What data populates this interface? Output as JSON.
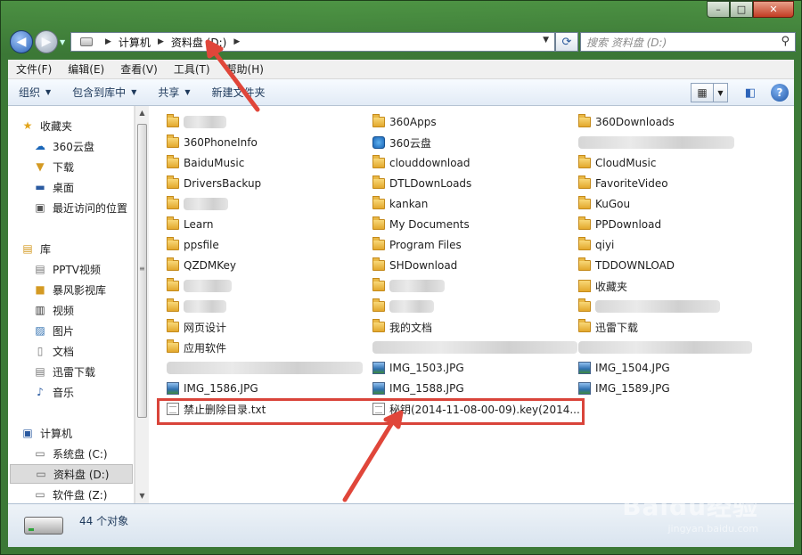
{
  "window": {
    "caption": {
      "minimize": "–",
      "maximize": "□",
      "close": "✕"
    }
  },
  "address": {
    "crumbs": [
      "计算机",
      "资料盘 (D:)"
    ],
    "search_placeholder": "搜索 资料盘 (D:)"
  },
  "menu": [
    "文件(F)",
    "编辑(E)",
    "查看(V)",
    "工具(T)",
    "帮助(H)"
  ],
  "commands": [
    {
      "label": "组织",
      "dropdown": true
    },
    {
      "label": "包含到库中",
      "dropdown": true
    },
    {
      "label": "共享",
      "dropdown": true
    },
    {
      "label": "新建文件夹",
      "dropdown": false
    }
  ],
  "nav": {
    "favorites": {
      "label": "收藏夹",
      "items": [
        "360云盘",
        "下载",
        "桌面",
        "最近访问的位置"
      ]
    },
    "libraries": {
      "label": "库",
      "items": [
        "PPTV视频",
        "暴风影视库",
        "视频",
        "图片",
        "文档",
        "迅雷下载",
        "音乐"
      ]
    },
    "computer": {
      "label": "计算机",
      "items": [
        "系统盘 (C:)",
        "资料盘 (D:)",
        "软件盘 (Z:)"
      ],
      "selected": "资料盘 (D:)"
    }
  },
  "files": [
    {
      "name": "",
      "type": "folder",
      "blurred": true
    },
    {
      "name": "360Apps",
      "type": "folder"
    },
    {
      "name": "360Downloads",
      "type": "folder"
    },
    {
      "name": "360PhoneInfo",
      "type": "folder"
    },
    {
      "name": "360云盘",
      "type": "cloud"
    },
    {
      "name": "",
      "type": "blank",
      "blurred": true
    },
    {
      "name": "BaiduMusic",
      "type": "folder"
    },
    {
      "name": "clouddownload",
      "type": "folder"
    },
    {
      "name": "CloudMusic",
      "type": "folder"
    },
    {
      "name": "DriversBackup",
      "type": "folder"
    },
    {
      "name": "DTLDownLoads",
      "type": "folder"
    },
    {
      "name": "FavoriteVideo",
      "type": "folder"
    },
    {
      "name": "",
      "type": "folder",
      "blurred": true
    },
    {
      "name": "kankan",
      "type": "folder"
    },
    {
      "name": "KuGou",
      "type": "folder"
    },
    {
      "name": "Learn",
      "type": "folder"
    },
    {
      "name": "My Documents",
      "type": "folder"
    },
    {
      "name": "PPDownload",
      "type": "folder"
    },
    {
      "name": "ppsfile",
      "type": "folder"
    },
    {
      "name": "Program Files",
      "type": "folder"
    },
    {
      "name": "qiyi",
      "type": "folder"
    },
    {
      "name": "QZDMKey",
      "type": "folder"
    },
    {
      "name": "SHDownload",
      "type": "folder"
    },
    {
      "name": "TDDOWNLOAD",
      "type": "folder"
    },
    {
      "name": "",
      "type": "folder",
      "blurred": true
    },
    {
      "name": "",
      "type": "folder",
      "blurred": true
    },
    {
      "name": "收藏夹",
      "type": "fav"
    },
    {
      "name": "",
      "type": "folder",
      "blurred": true
    },
    {
      "name": "",
      "type": "folder",
      "blurred": true
    },
    {
      "name": "",
      "type": "folder",
      "blurred": true
    },
    {
      "name": "网页设计",
      "type": "folder"
    },
    {
      "name": "我的文档",
      "type": "folder"
    },
    {
      "name": "迅雷下载",
      "type": "folder"
    },
    {
      "name": "应用软件",
      "type": "folder"
    },
    {
      "name": "",
      "type": "blank",
      "blurred": true
    },
    {
      "name": "",
      "type": "blank",
      "blurred": true
    },
    {
      "name": "",
      "type": "blank",
      "blurred": true
    },
    {
      "name": "IMG_1503.JPG",
      "type": "image"
    },
    {
      "name": "IMG_1504.JPG",
      "type": "image"
    },
    {
      "name": "IMG_1586.JPG",
      "type": "image"
    },
    {
      "name": "IMG_1588.JPG",
      "type": "image"
    },
    {
      "name": "IMG_1589.JPG",
      "type": "image"
    },
    {
      "name": "禁止删除目录.txt",
      "type": "doc"
    },
    {
      "name": "秘钥(2014-11-08-00-09).key(2014...",
      "type": "doc"
    }
  ],
  "status": {
    "count": "44 个对象"
  },
  "watermark": {
    "brand": "Baidu经验",
    "url": "jingyan.baidu.com"
  },
  "colors": {
    "annotation": "#d9443a",
    "window_frame": "#3f8a39",
    "selection": "#dcdcdc"
  }
}
